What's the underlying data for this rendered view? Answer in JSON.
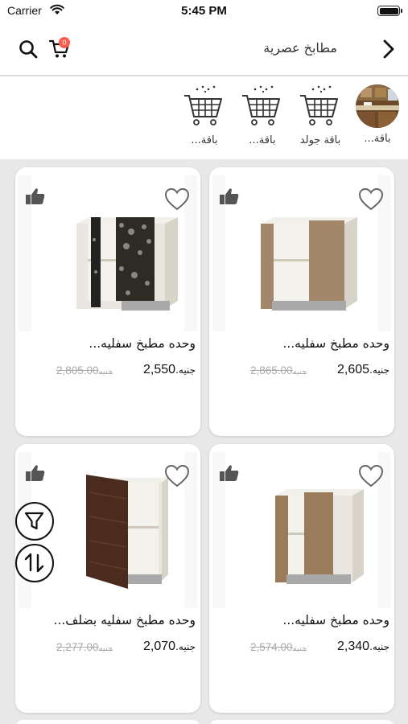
{
  "status_bar": {
    "carrier": "Carrier",
    "time": "5:45 PM"
  },
  "header": {
    "title": "مطابخ عصرية",
    "cart_count": "0"
  },
  "categories": [
    {
      "label": "باقة...",
      "icon": "kitchen-photo"
    },
    {
      "label": "باقة جولد",
      "icon": "cart-icon"
    },
    {
      "label": "باقة...",
      "icon": "cart-icon"
    },
    {
      "label": "باقة...",
      "icon": "cart-icon"
    }
  ],
  "products": [
    {
      "name": "وحده مطبخ سفليه...",
      "price": "2,605",
      "old_price": "2,865.00",
      "currency": "جنيه",
      "cabinet_color": "#a3876a"
    },
    {
      "name": "وحده مطبخ سفليه...",
      "price": "2,550",
      "old_price": "2,805.00",
      "currency": "جنيه",
      "cabinet_color": "#2e2b25"
    },
    {
      "name": "وحده مطبخ سفليه...",
      "price": "2,340",
      "old_price": "2,574.00",
      "currency": "جنيه",
      "cabinet_color": "#9a7c5c"
    },
    {
      "name": "وحده مطبخ سفليه بضلف...",
      "price": "2,070",
      "old_price": "2,277.00",
      "currency": "جنيه",
      "cabinet_color": "#4a2b1e"
    }
  ],
  "colors": {
    "badge": "#ff5a4e",
    "background": "#e8e8e8",
    "old_price": "#aaaaaa"
  }
}
